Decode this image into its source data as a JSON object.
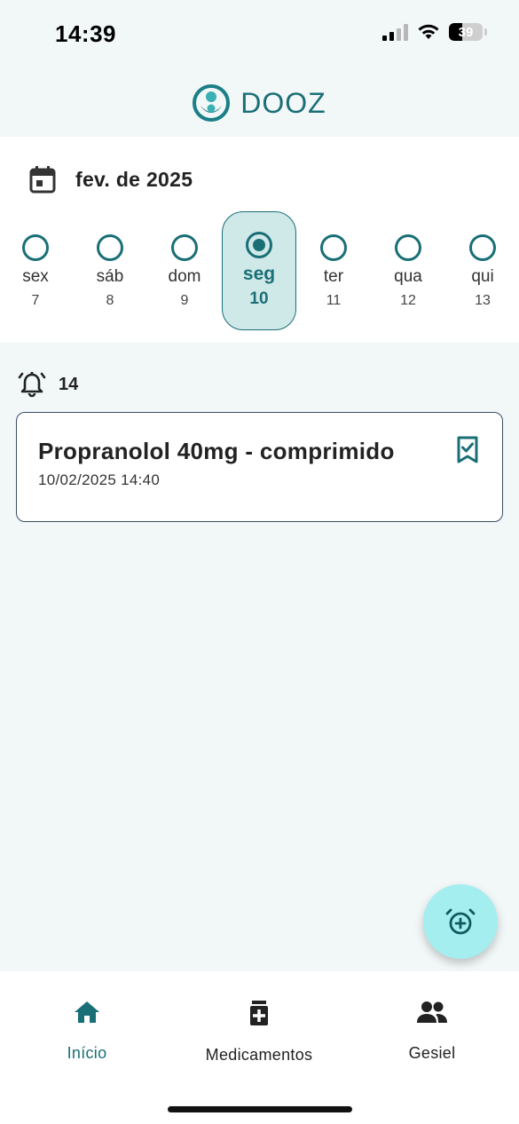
{
  "status_bar": {
    "time": "14:39",
    "battery": "39"
  },
  "header": {
    "app_name": "DOOZ",
    "accent": "#1a6f77"
  },
  "calendar": {
    "month": "fev. de 2025",
    "days": [
      {
        "name": "sex",
        "num": "7"
      },
      {
        "name": "sáb",
        "num": "8"
      },
      {
        "name": "dom",
        "num": "9"
      },
      {
        "name": "seg",
        "num": "10",
        "selected": true
      },
      {
        "name": "ter",
        "num": "11"
      },
      {
        "name": "qua",
        "num": "12"
      },
      {
        "name": "qui",
        "num": "13"
      }
    ]
  },
  "schedule": {
    "hour": "14",
    "items": [
      {
        "name": "Propranolol 40mg - comprimido",
        "datetime": "10/02/2025 14:40",
        "icon": "bookmark-check-icon"
      }
    ]
  },
  "fab": {
    "icon": "alarm-add-icon"
  },
  "nav": {
    "items": [
      {
        "label": "Início",
        "icon": "home-icon",
        "active": true
      },
      {
        "label": "Medicamentos",
        "icon": "medication-icon"
      },
      {
        "label": "Gesiel",
        "icon": "people-icon"
      }
    ]
  }
}
